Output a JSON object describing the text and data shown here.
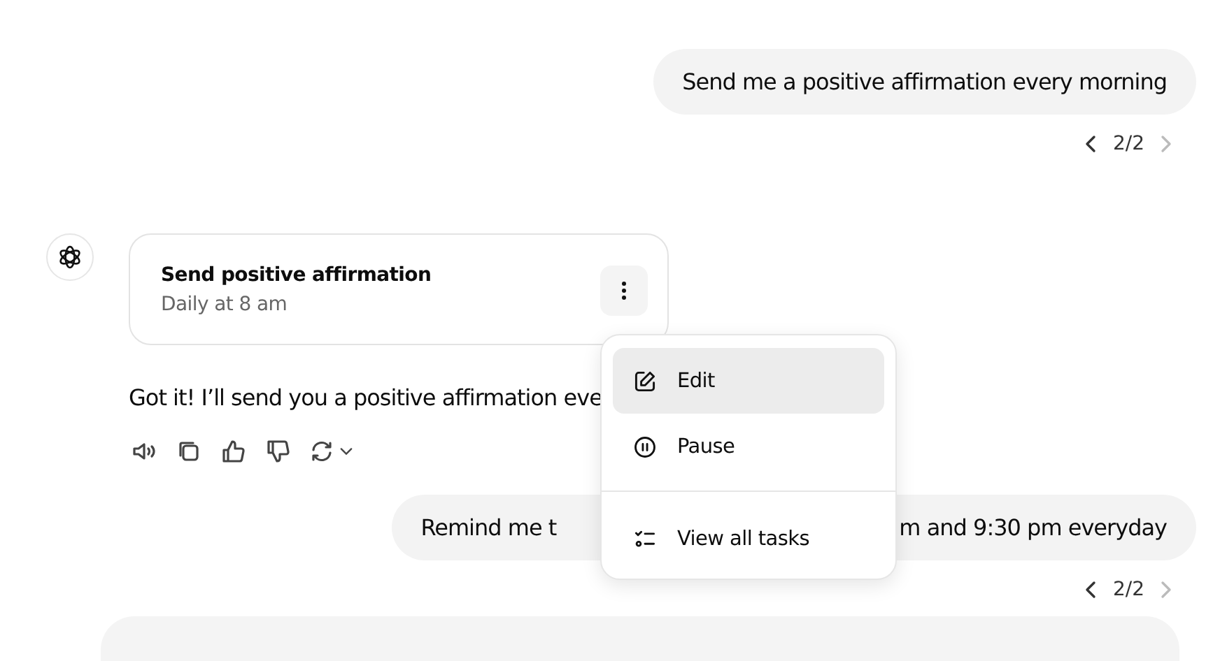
{
  "messages": [
    {
      "kind": "user",
      "parts": [
        "Send me a positive affirmation every morning"
      ],
      "pager": {
        "text": "2/2",
        "prev_disabled": false,
        "next_disabled": true
      }
    },
    {
      "kind": "assistant",
      "task": {
        "title": "Send positive affirmation",
        "schedule": "Daily at 8 am"
      },
      "text": "Got it! I’ll send you a positive affirmation eve",
      "actions": [
        {
          "kind": "speaker"
        },
        {
          "kind": "copy"
        },
        {
          "kind": "thumbs-up"
        },
        {
          "kind": "thumbs-down"
        },
        {
          "kind": "regenerate"
        }
      ]
    },
    {
      "kind": "user",
      "parts": [
        "Remind me t",
        "m and 9:30 pm everyday"
      ],
      "pager": {
        "text": "2/2",
        "prev_disabled": false,
        "next_disabled": true
      }
    }
  ],
  "menu": {
    "items": [
      {
        "kind": "edit",
        "label": "Edit",
        "highlighted": true,
        "divider_before": false
      },
      {
        "kind": "pause",
        "label": "Pause",
        "highlighted": false,
        "divider_before": false
      },
      {
        "kind": "tasks",
        "label": "View all tasks",
        "highlighted": false,
        "divider_before": true
      }
    ]
  }
}
